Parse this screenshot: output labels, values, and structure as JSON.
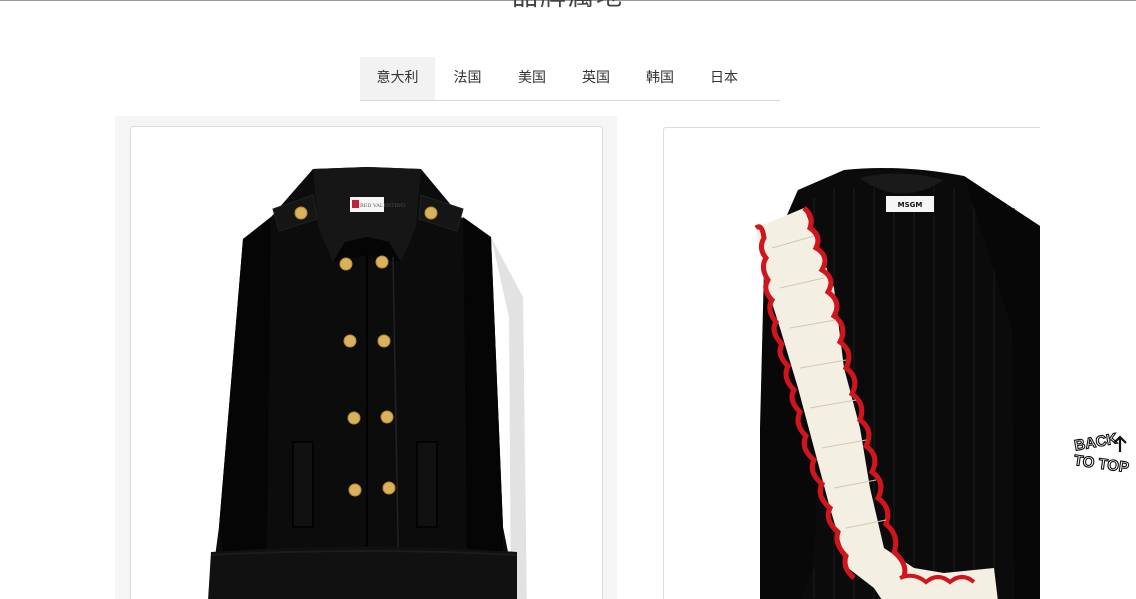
{
  "section": {
    "title": "品牌属地"
  },
  "tabs": [
    {
      "label": "意大利",
      "active": true
    },
    {
      "label": "法国",
      "active": false
    },
    {
      "label": "美国",
      "active": false
    },
    {
      "label": "英国",
      "active": false
    },
    {
      "label": "韩国",
      "active": false
    },
    {
      "label": "日本",
      "active": false
    }
  ],
  "products": [
    {
      "image": "black-double-breasted-cape-coat",
      "brand_tag": "RED VALENTINO"
    },
    {
      "image": "black-ribbed-sweater-with-ruffle",
      "brand_tag": "MSGM"
    }
  ],
  "back_to_top": {
    "line1": "BACK",
    "line2": "TO TOP",
    "icon": "arrow-up-icon"
  },
  "colors": {
    "tab_active_bg": "#f2f2f2",
    "coat": "#0c0c0c",
    "button_gold": "#d9b25b",
    "ruffle_red": "#d0161c",
    "ruffle_cream": "#f3efe2"
  }
}
